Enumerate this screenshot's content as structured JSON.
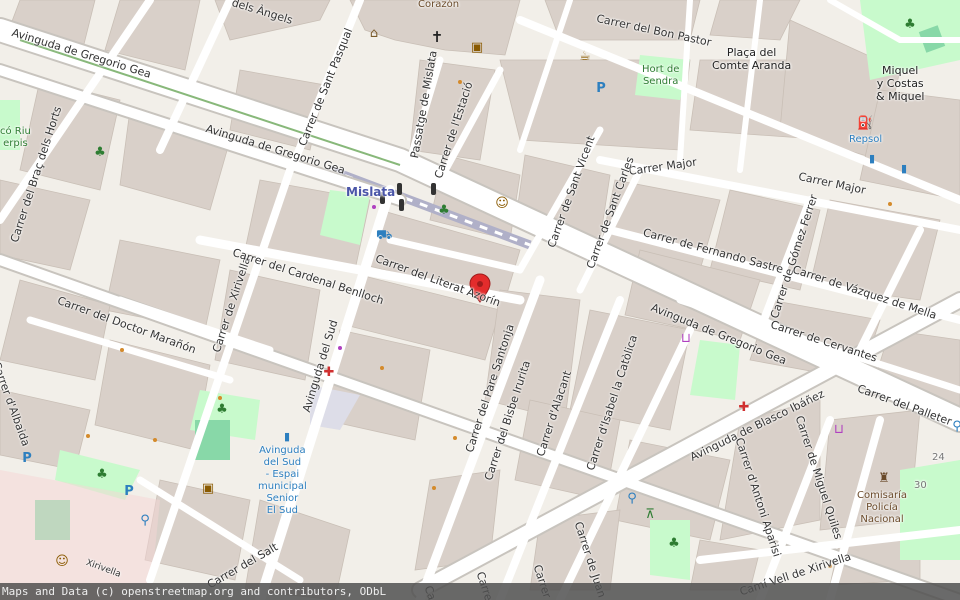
{
  "map": {
    "streets": [
      {
        "key": "gregorio_gea_w",
        "text": "Avinguda de Gregorio Gea"
      },
      {
        "key": "gregorio_gea_c",
        "text": "Avinguda de Gregorio Gea"
      },
      {
        "key": "gregorio_gea_e",
        "text": "Avinguda de Gregorio Gea"
      },
      {
        "key": "angels",
        "text": "dels Àngels"
      },
      {
        "key": "sant_pasqual",
        "text": "Carrer de Sant Pasqual"
      },
      {
        "key": "passatge_mislata",
        "text": "Passatge de Mislata"
      },
      {
        "key": "estacio",
        "text": "Carrer de l'Estació"
      },
      {
        "key": "bon_pastor",
        "text": "Carrer del Bon Pastor"
      },
      {
        "key": "major_w",
        "text": "Carrer Major"
      },
      {
        "key": "major_e",
        "text": "Carrer Major"
      },
      {
        "key": "sant_vicent",
        "text": "Carrer de Sant Vicent"
      },
      {
        "key": "sant_carles",
        "text": "Carrer de Sant Carles"
      },
      {
        "key": "braç_horts",
        "text": "Carrer del Braç dels Horts"
      },
      {
        "key": "xirivella",
        "text": "Carrer de Xirivella"
      },
      {
        "key": "cardenal_benlloch",
        "text": "Carrer del Cardenal Benlloch"
      },
      {
        "key": "literat_azorin",
        "text": "Carrer del Literat Azorín"
      },
      {
        "key": "doctor_maranon",
        "text": "Carrer del Doctor Marañón"
      },
      {
        "key": "av_sud",
        "text": "Avinguda del Sud"
      },
      {
        "key": "pare_santonja",
        "text": "Carrer del Pare Santonja"
      },
      {
        "key": "bisbe_irurita",
        "text": "Carrer del Bisbe Irurita"
      },
      {
        "key": "alacant",
        "text": "Carrer d'Alacant"
      },
      {
        "key": "isabel_catolica",
        "text": "Carrer d'Isabel la Catòlica"
      },
      {
        "key": "fernando_sastre",
        "text": "Carrer de Fernando Sastre"
      },
      {
        "key": "gomez_ferrer",
        "text": "Carrer de Gómez Ferrer"
      },
      {
        "key": "vazquez_mella",
        "text": "Carrer de Vázquez de Mella"
      },
      {
        "key": "cervantes",
        "text": "Carrer de Cervantes"
      },
      {
        "key": "palleter",
        "text": "Carrer del Palleter"
      },
      {
        "key": "blasco_ibanez",
        "text": "Avinguda de Blasco Ibáñez"
      },
      {
        "key": "antoni_aparisi",
        "text": "Carrer d'Antoni Aparisi"
      },
      {
        "key": "miguel_quiles",
        "text": "Carrer de Miguel Quiles"
      },
      {
        "key": "cami_xirivella",
        "text": "Camí Vell de Xirivella"
      },
      {
        "key": "salt",
        "text": "Carrer del Salt"
      },
      {
        "key": "albaida",
        "text": "Carrer d'Albaida"
      },
      {
        "key": "xirivella_s",
        "text": "Xirivella"
      },
      {
        "key": "juan_d",
        "text": "Carrer de Juan d"
      },
      {
        "key": "carrer_s",
        "text": "Carrer d"
      },
      {
        "key": "carrer_s2",
        "text": "Carre"
      },
      {
        "key": "carrer_s3",
        "text": "Ca"
      }
    ],
    "places": [
      {
        "key": "placa_comte",
        "text": "Plaça del\nComte Aranda"
      },
      {
        "key": "hort_sendra",
        "text": "Hort de\nSendra"
      },
      {
        "key": "miquel_costas",
        "text": "Miquel\ny Costas\n& Miquel"
      },
      {
        "key": "repsol",
        "text": "Repsol"
      },
      {
        "key": "mislata",
        "text": "Mislata"
      },
      {
        "key": "av_sud_espai",
        "text": "Avinguda\ndel Sud\n- Espai\nmunicipal\nSenior\nEl Sud"
      },
      {
        "key": "comisaria",
        "text": "Comisaría\nPolicía\nNacional"
      },
      {
        "key": "corazon",
        "text": "Corazón"
      },
      {
        "key": "riu",
        "text": "có Riu\nerpis"
      },
      {
        "key": "num24",
        "text": "24"
      },
      {
        "key": "num30",
        "text": "30"
      }
    ],
    "colors": {
      "background": "#f2efe9",
      "building": "#d9d0c9",
      "road": "#ffffff",
      "road_casing": "#c8c4be",
      "park": "#c8facc",
      "pitch": "#88d8a8",
      "rail": "#b0b0c8",
      "marker": "#e32c2c",
      "station": "#4a55a8"
    },
    "icons": [
      "church-icon",
      "bookshop-icon",
      "cafe-icon",
      "parking-icon",
      "fuel-icon",
      "bus-stop-icon",
      "theatre-icon",
      "tram-icon",
      "taxi-icon",
      "pharmacy-icon",
      "shop-cart-icon",
      "police-icon",
      "bicycle-icon",
      "playground-icon",
      "picnic-icon",
      "location-marker-icon",
      "traffic-signal-icon"
    ]
  },
  "attribution": "Maps and Data (c) openstreetmap.org and contributors, ODbL"
}
